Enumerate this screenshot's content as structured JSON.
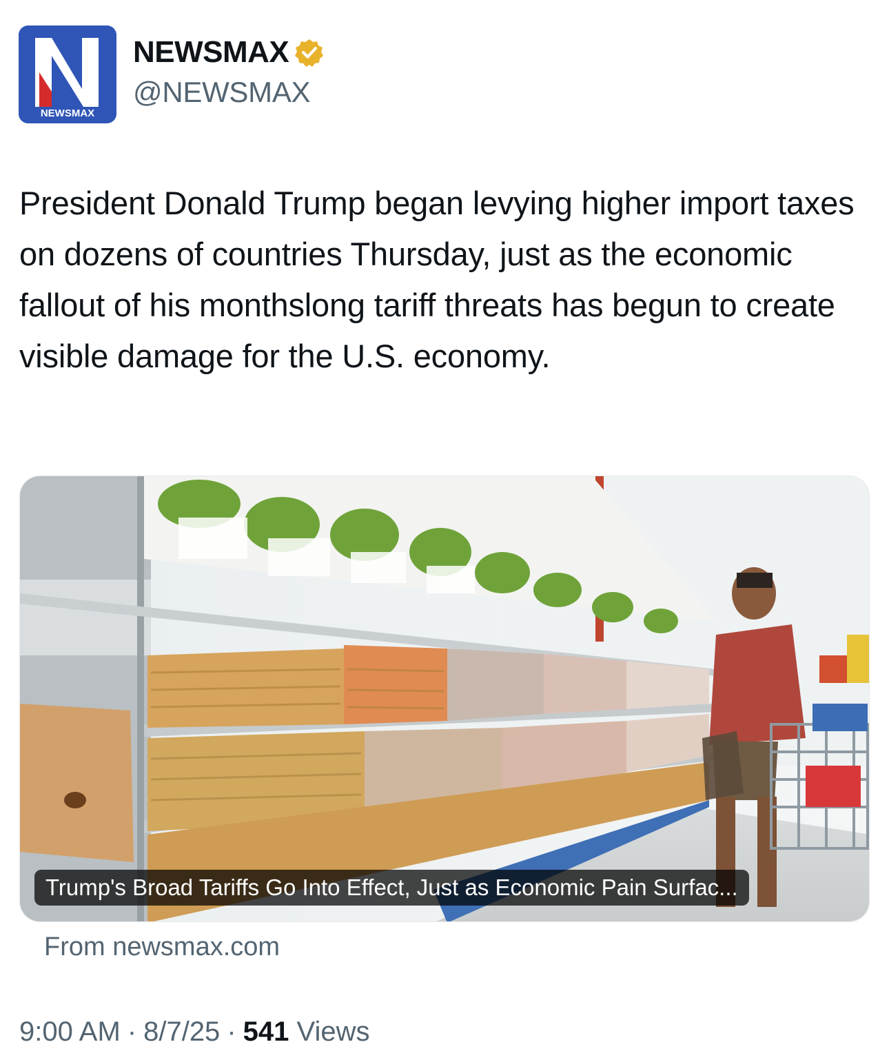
{
  "author": {
    "display_name": "NEWSMAX",
    "handle": "@NEWSMAX",
    "avatar_label": "NEWSMAX",
    "avatar_letter": "N",
    "verified": true
  },
  "tweet": {
    "text": "President Donald Trump began levying higher import taxes on dozens of countries Thursday, just as the economic fallout of his monthslong tariff threats has begun to create visible damage for the U.S. economy."
  },
  "card": {
    "title": "Trump's Broad Tariffs Go Into Effect, Just as Economic Pain Surfac...",
    "source": "From newsmax.com",
    "image_description_icon": "grocery-aisle-photo"
  },
  "meta": {
    "time": "9:00 AM",
    "separator": "·",
    "date": "8/7/25",
    "views_count": "541",
    "views_label": "Views"
  },
  "colors": {
    "avatar_blue": "#2f55b7",
    "avatar_red": "#d62b2b",
    "verified_gold": "#e8b22b",
    "secondary_text": "#536471",
    "primary_text": "#0f1419"
  }
}
